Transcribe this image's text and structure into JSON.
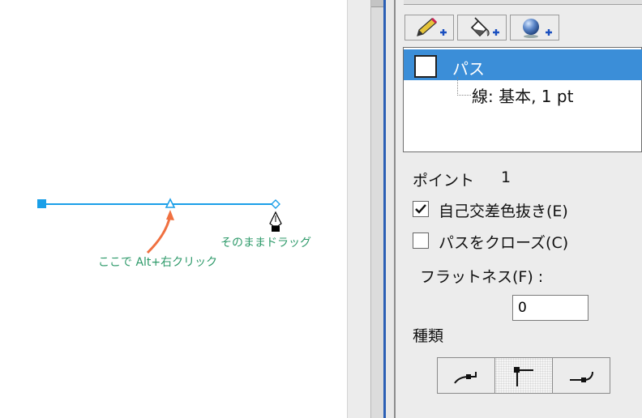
{
  "canvas": {
    "annotation_drag": "そのままドラッグ",
    "annotation_click": "ここで Alt+右クリック",
    "colors": {
      "path": "#1a9fe8",
      "anchor": "#1a9fe8",
      "arrow": "#f07040",
      "note": "#2e9a6a"
    }
  },
  "panel": {
    "toolbar": [
      {
        "icon": "pencil-add-icon"
      },
      {
        "icon": "fill-bucket-add-icon"
      },
      {
        "icon": "sphere-add-icon"
      }
    ],
    "tree": {
      "selected_label": "パス",
      "child_label": "線: 基本, 1 pt"
    },
    "point_label": "ポイント",
    "point_value": "1",
    "self_intersect_label": "自己交差色抜き(E)",
    "self_intersect_checked": true,
    "close_path_label": "パスをクローズ(C)",
    "close_path_checked": false,
    "flatness_label": "フラットネス(F) :",
    "flatness_value": "0",
    "type_label": "種類",
    "type_buttons": [
      {
        "icon": "curve-point-icon"
      },
      {
        "icon": "corner-point-icon",
        "active": true
      },
      {
        "icon": "smooth-point-icon"
      }
    ]
  }
}
